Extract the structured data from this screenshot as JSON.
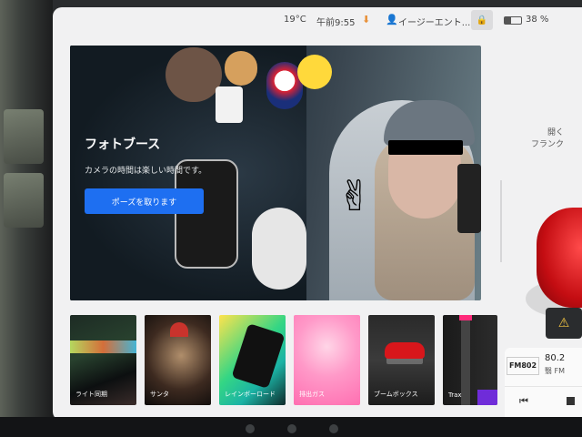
{
  "status": {
    "temperature": "19°C",
    "time": "午前9:55",
    "profile": "イージーエント...",
    "battery_pct": "38 %",
    "battery_level": 0.38
  },
  "hero": {
    "title": "フォトブース",
    "description": "カメラの時間は楽しい時間です。",
    "button_label": "ポーズを取ります"
  },
  "right": {
    "frunk_line1": "開く",
    "frunk_line2": "フランク"
  },
  "media": {
    "station_logo": "FM802",
    "frequency": "80.2",
    "band": "FM",
    "band_prefix": "翳"
  },
  "tiles": [
    {
      "label": "ライト同期"
    },
    {
      "label": "サンタ"
    },
    {
      "label": "レインボーロード"
    },
    {
      "label": "排出ガス"
    },
    {
      "label": "ブームボックス"
    },
    {
      "label": "Trax"
    }
  ],
  "colors": {
    "accent": "#1e6ff1",
    "car": "#c40d12",
    "warning": "#f5c642"
  },
  "icons": {
    "download": "download-icon",
    "user": "user-icon",
    "lock": "lock-icon",
    "warning": "warning-icon",
    "prev": "skip-previous-icon",
    "stop": "stop-icon"
  }
}
